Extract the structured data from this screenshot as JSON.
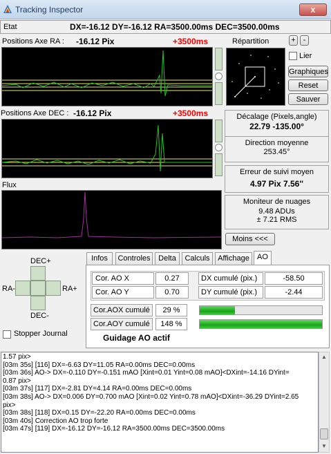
{
  "window": {
    "title": "Tracking Inspector",
    "close": "x"
  },
  "etat": {
    "label": "Etat",
    "value": "DX=-16.12  DY=-16.12  RA=3500.00ms   DEC=3500.00ms"
  },
  "ra_panel": {
    "label": "Positions Axe RA :",
    "pix": "-16.12 Pix",
    "ms": "+3500ms"
  },
  "dec_panel": {
    "label": "Positions Axe DEC :",
    "pix": "-16.12 Pix",
    "ms": "+3500ms"
  },
  "flux": {
    "label": "Flux"
  },
  "repartition": {
    "label": "Répartition",
    "plus": "+",
    "minus": "-"
  },
  "lier": {
    "label": "Lier"
  },
  "buttons": {
    "graphiques": "Graphiques",
    "reset": "Reset",
    "sauver": "Sauver",
    "moins": "Moins <<<"
  },
  "decalage": {
    "title": "Décalage (Pixels,angle)",
    "value": "22.79   -135.00°"
  },
  "direction": {
    "title": "Direction moyenne",
    "value": "253.45°"
  },
  "erreur": {
    "title": "Erreur de suivi moyen",
    "value": "4.97 Pix   7.56''"
  },
  "moniteur": {
    "title": "Moniteur de nuages",
    "adu": "9.48 ADUs",
    "rms": "± 7.21 RMS"
  },
  "pad": {
    "up": "DEC+",
    "down": "DEC-",
    "left": "RA-",
    "right": "RA+"
  },
  "stopper": {
    "label": "Stopper Journal"
  },
  "tabs": [
    "Infos",
    "Controles",
    "Delta",
    "Calculs",
    "Affichage",
    "AO"
  ],
  "ao": {
    "cor_x_label": "Cor. AO X",
    "cor_x": "0.27",
    "cor_y_label": "Cor. AO Y",
    "cor_y": "0.70",
    "dx_label": "DX cumulé (pix.)",
    "dx": "-58.50",
    "dy_label": "DY cumulé (pix.)",
    "dy": "-2.44",
    "aox_label": "Cor.AOX cumulé",
    "aox": "29 %",
    "aox_fill": 0.29,
    "aoy_label": "Cor.AOY cumulé",
    "aoy": "148 %",
    "aoy_fill": 1.0,
    "status": "Guidage AO  actif"
  },
  "log": [
    "1.57 pix>",
    "[03m 35s] [116] DX=-6.63  DY=11.05 RA=0.00ms  DEC=0.00ms",
    "[03m 36s] AO-> DX=-0.110 DY=-0.151 mAO  [Xint=0.01 Yint=0.08 mAO]<DXint=-14.16 DYint=",
    "0.87 pix>",
    "[03m 37s] [117] DX=-2.81  DY=4.14 RA=0.00ms  DEC=0.00ms",
    "[03m 38s] AO-> DX=0.006 DY=0.700 mAO  [Xint=0.02 Yint=0.78 mAO]<DXint=-36.29 DYint=2.65",
    "pix>",
    "[03m 38s] [118] DX=0.15  DY=-22.20 RA=0.00ms  DEC=0.00ms",
    "[03m 40s] Correction AO trop forte",
    "[03m 47s] [119] DX=-16.12  DY=-16.12 RA=3500.00ms  DEC=3500.00ms"
  ],
  "colors": {
    "accent_red": "#ff0000",
    "trace_green": "#22c522",
    "ref_yellow": "#e8e860",
    "flux_purple": "#a030a0"
  }
}
